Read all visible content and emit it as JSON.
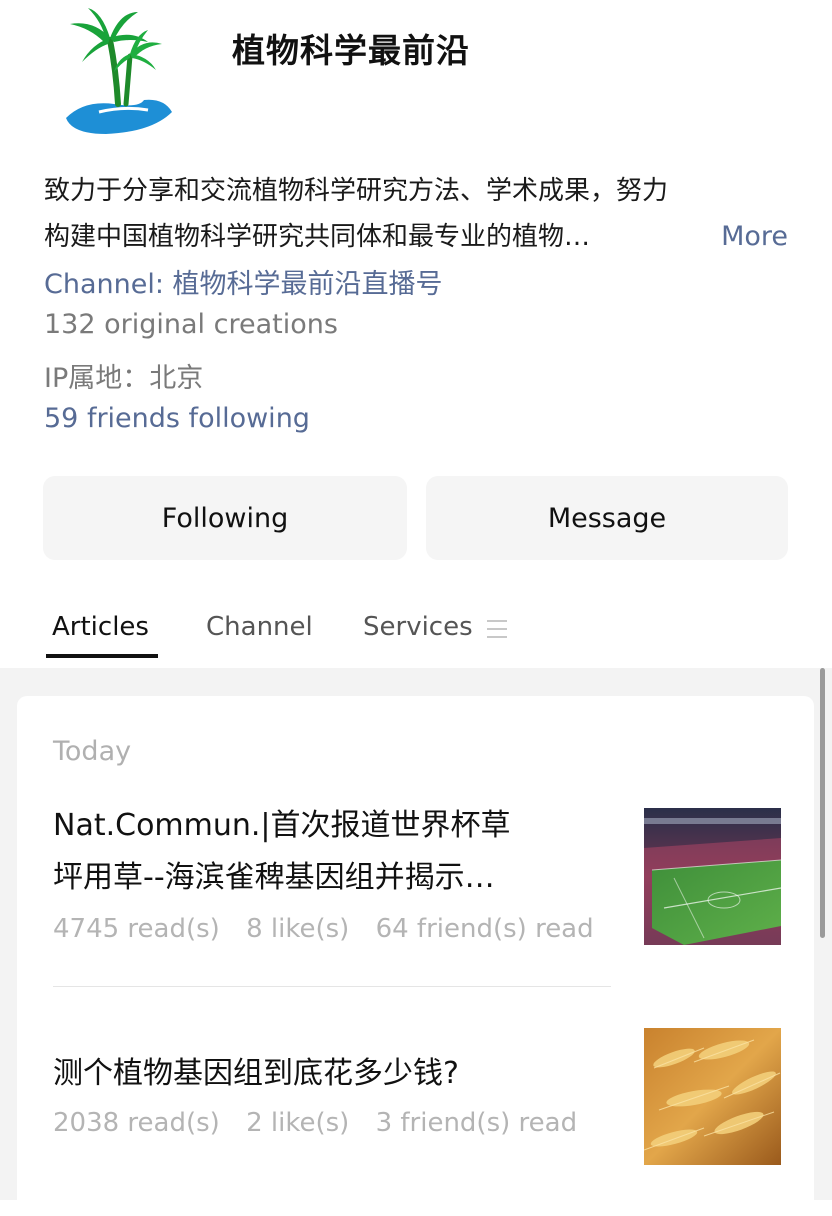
{
  "profile": {
    "name": "植物科学最前沿",
    "bio_line_1": "致力于分享和交流植物科学研究方法、学术成果，努力",
    "bio_line_2": "构建中国植物科学研究共同体和最专业的植物…",
    "more_label": "More",
    "channel": "Channel: 植物科学最前沿直播号",
    "original_creations": "132 original creations",
    "ip_location": "IP属地：北京",
    "friends_following": "59 friends following"
  },
  "actions": {
    "following_label": "Following",
    "message_label": "Message"
  },
  "tabs": [
    {
      "label": "Articles",
      "active": true
    },
    {
      "label": "Channel",
      "active": false
    },
    {
      "label": "Services",
      "active": false
    }
  ],
  "feed": {
    "section_label": "Today",
    "articles": [
      {
        "title_line_1": "Nat.Commun.|首次报道世界杯草",
        "title_line_2": "坪用草--海滨雀稗基因组并揭示…",
        "reads": "4745 read(s)",
        "likes": "8 like(s)",
        "friends_read": "64 friend(s) read",
        "thumbnail_icon": "stadium-image"
      },
      {
        "title_line_1": "测个植物基因组到底花多少钱?",
        "reads": "2038 read(s)",
        "likes": "2 like(s)",
        "friends_read": "3 friend(s) read",
        "thumbnail_icon": "wheat-image"
      }
    ]
  },
  "icons": {
    "avatar": "palm-tree-island-logo",
    "services_menu": "menu-icon"
  },
  "colors": {
    "link_blue": "#576b95",
    "muted_gray": "#7a7a7a",
    "button_bg": "#f5f5f5",
    "feed_bg": "#f3f3f3"
  }
}
